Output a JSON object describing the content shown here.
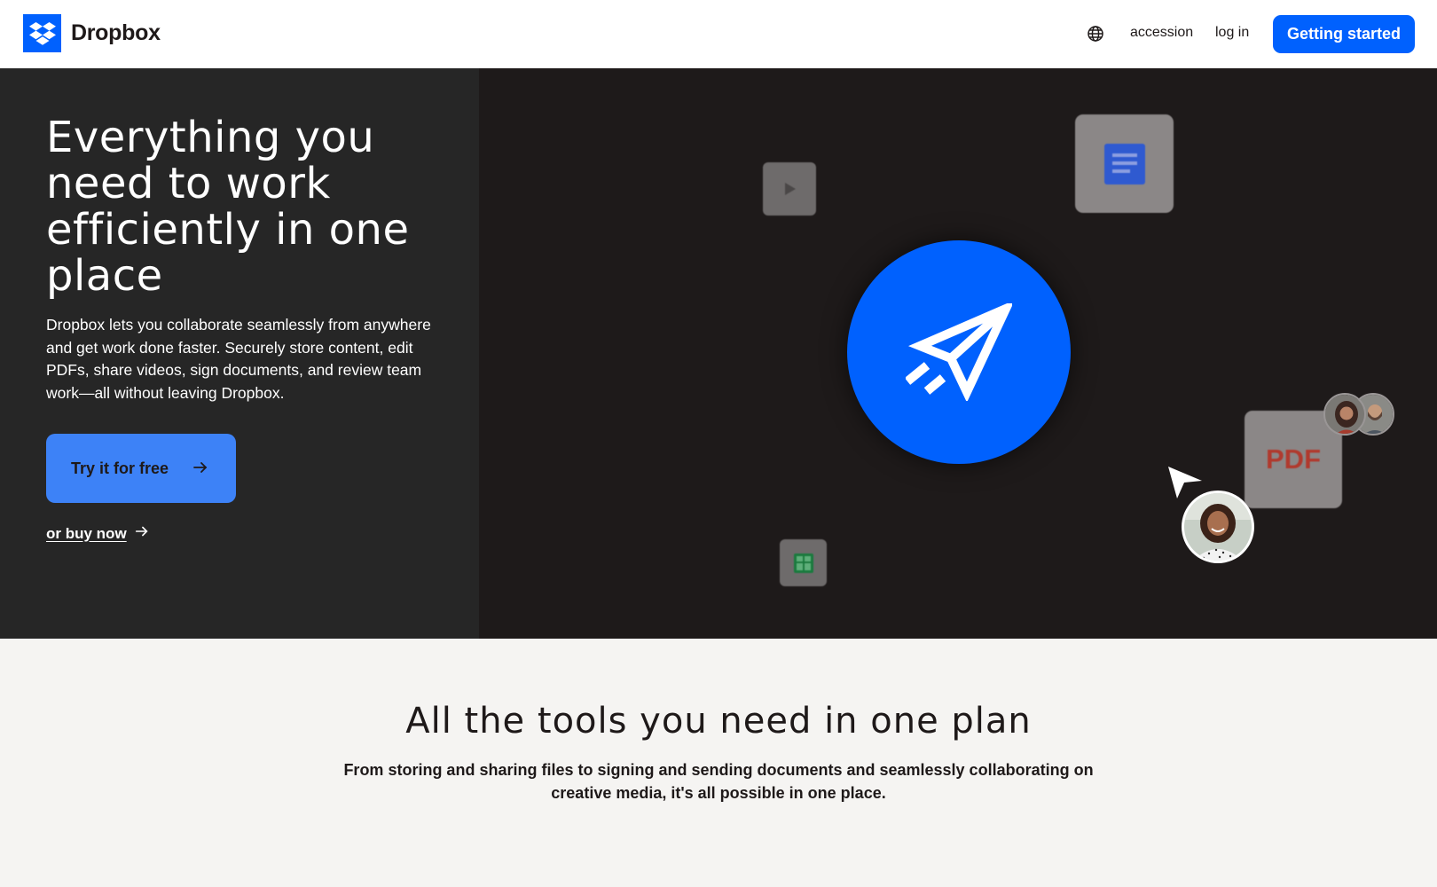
{
  "header": {
    "brand": "Dropbox",
    "nav": {
      "accession": "accession",
      "login": "log in"
    },
    "cta": "Getting started",
    "icons": {
      "logo": "dropbox-logo-icon",
      "language": "globe-icon"
    },
    "colors": {
      "brand_blue": "#0061fe"
    }
  },
  "hero": {
    "title": "Everything you need to work efficiently in one place",
    "description": "Dropbox lets you collaborate seamlessly from anywhere and get work done faster. Securely store content, edit PDFs, share videos, sign documents, and review team work—all without leaving Dropbox.",
    "primary_cta": "Try it for free",
    "secondary_cta": "or buy now",
    "illustration": {
      "pdf_label": "PDF",
      "icons": [
        "video-play-icon",
        "document-icon",
        "spreadsheet-icon",
        "paper-plane-icon",
        "cursor-pointer-icon"
      ]
    }
  },
  "plan_section": {
    "title": "All the tools you need in one plan",
    "description": "From storing and sharing files to signing and sending documents and seamlessly collaborating on creative media, it's all possible in one place."
  }
}
